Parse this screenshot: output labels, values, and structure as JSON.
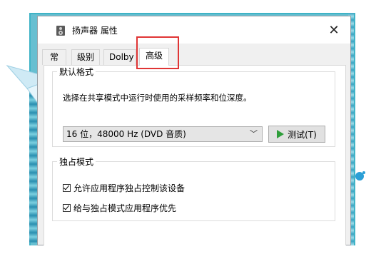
{
  "window": {
    "title": "扬声器 属性",
    "close_glyph": "✕"
  },
  "tabs": [
    {
      "label": "常规"
    },
    {
      "label": "级别"
    },
    {
      "label": "Dolby"
    },
    {
      "label": "高级",
      "active": true
    }
  ],
  "default_format": {
    "legend": "默认格式",
    "description": "选择在共享模式中运行时使用的采样频率和位深度。",
    "selected": "16 位，48000 Hz (DVD 音质)",
    "test_button": "测试(T)"
  },
  "exclusive_mode": {
    "legend": "独占模式",
    "options": [
      {
        "label": "允许应用程序独占控制该设备",
        "checked": true
      },
      {
        "label": "给与独占模式应用程序优先",
        "checked": true
      }
    ]
  },
  "colors": {
    "highlight": "#e03535",
    "background_accent": "#67bfd1",
    "play_icon": "#2e9e3a"
  },
  "icons": [
    "speaker-icon",
    "close-icon",
    "chevron-down-icon",
    "play-icon",
    "checkbox-icon"
  ]
}
